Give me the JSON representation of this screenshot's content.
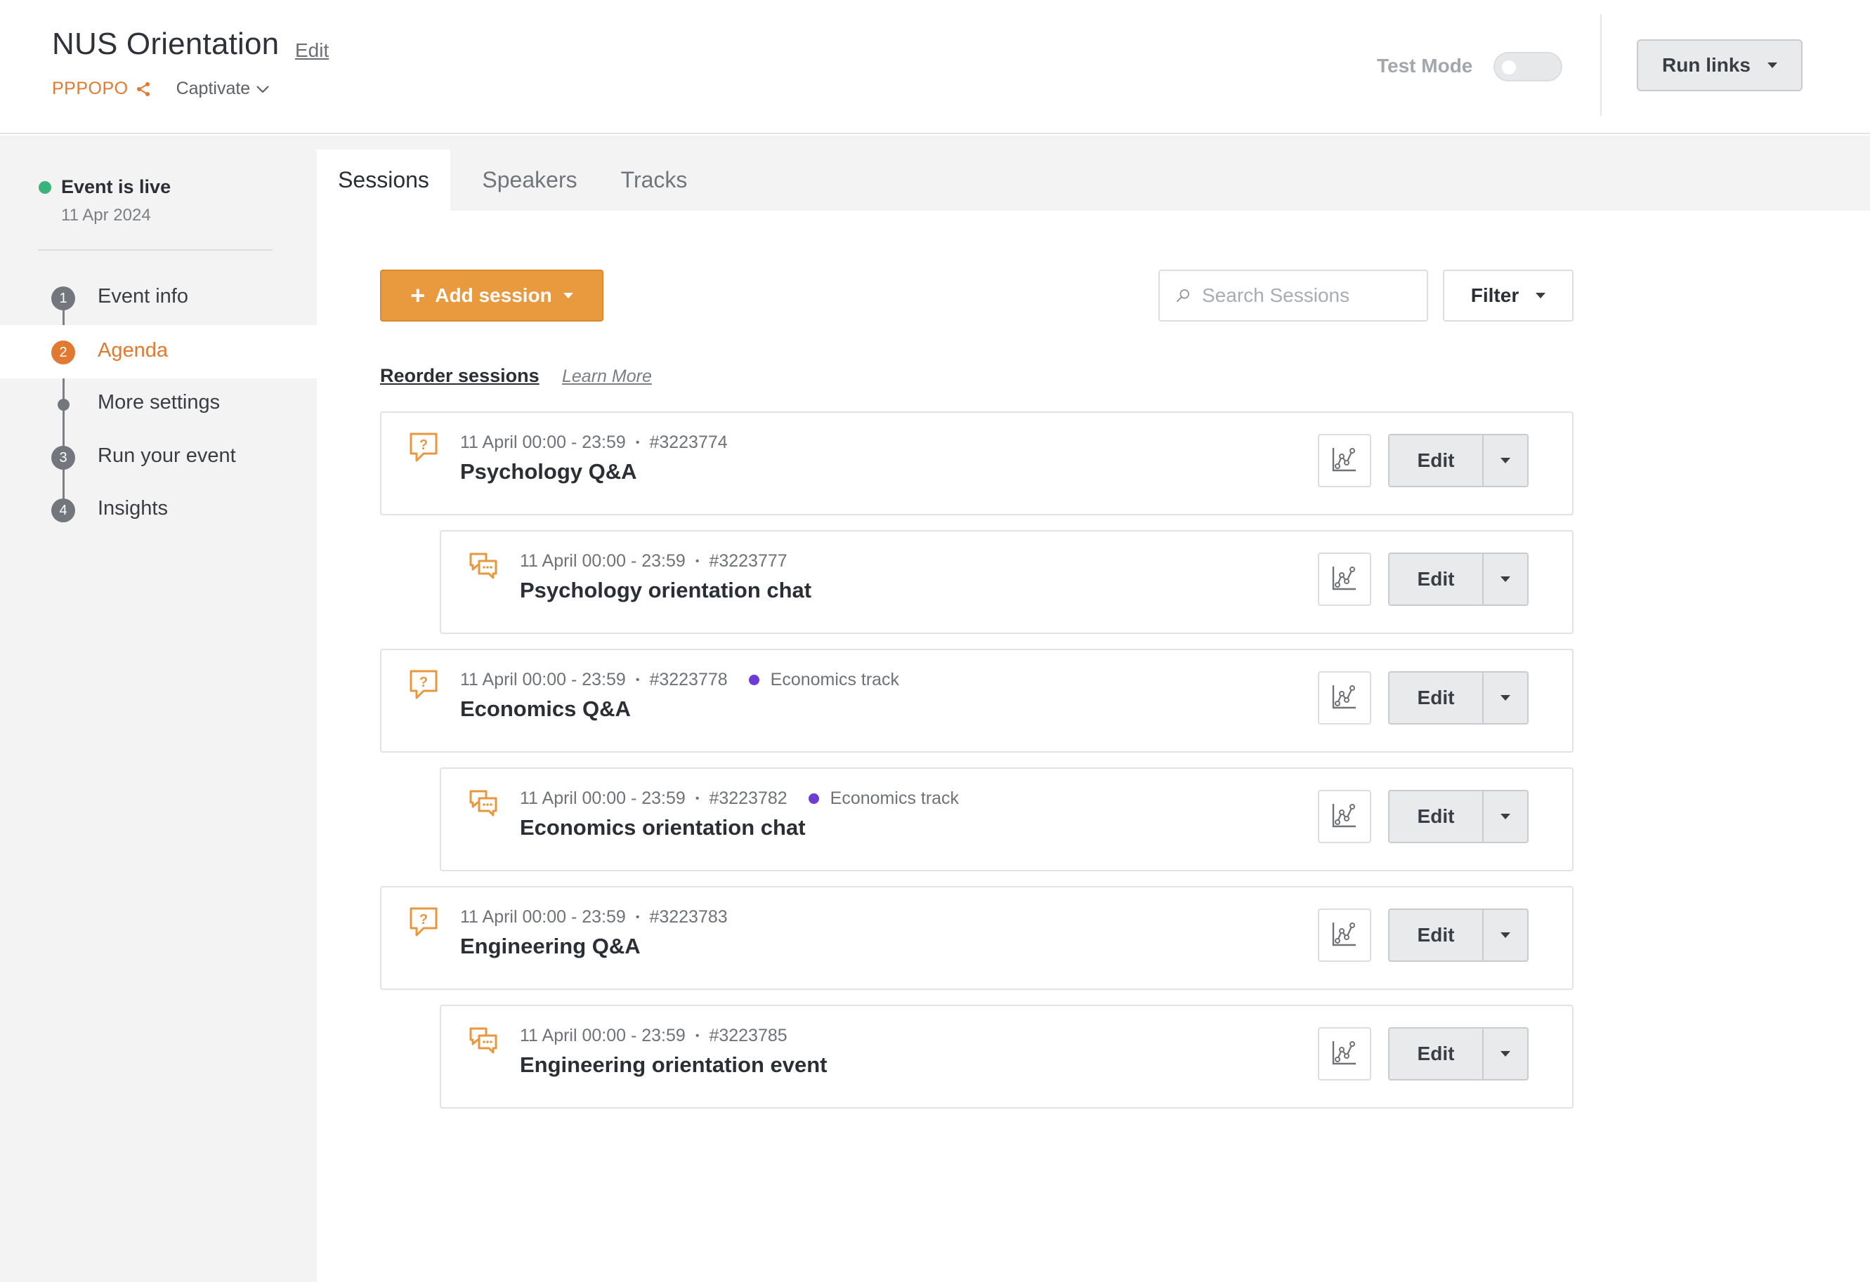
{
  "header": {
    "event_title": "NUS Orientation",
    "edit_label": "Edit",
    "org_code": "PPPOPO",
    "platform": "Captivate",
    "test_mode_label": "Test Mode",
    "test_mode_on": false,
    "run_links_label": "Run links"
  },
  "sidebar": {
    "status": "Event is live",
    "date": "11 Apr 2024",
    "steps": [
      {
        "number": "1",
        "label": "Event info",
        "active": false
      },
      {
        "number": "2",
        "label": "Agenda",
        "active": true
      },
      {
        "number": "",
        "label": "More settings",
        "active": false
      },
      {
        "number": "3",
        "label": "Run your event",
        "active": false
      },
      {
        "number": "4",
        "label": "Insights",
        "active": false
      }
    ]
  },
  "tabs": [
    {
      "label": "Sessions",
      "active": true
    },
    {
      "label": "Speakers",
      "active": false
    },
    {
      "label": "Tracks",
      "active": false
    }
  ],
  "toolbar": {
    "add_session_label": "Add session",
    "search_placeholder": "Search Sessions",
    "filter_label": "Filter",
    "reorder_label": "Reorder sessions",
    "learn_more_label": "Learn More"
  },
  "sessions": [
    {
      "type": "qa",
      "icon": "qa-bubble-icon",
      "time": "11 April 00:00 - 23:59",
      "id": "#3223774",
      "track": "",
      "title": "Psychology Q&A",
      "edit_label": "Edit"
    },
    {
      "type": "chat",
      "icon": "chat-bubbles-icon",
      "time": "11 April 00:00 - 23:59",
      "id": "#3223777",
      "track": "",
      "title": "Psychology orientation chat",
      "edit_label": "Edit"
    },
    {
      "type": "qa",
      "icon": "qa-bubble-icon",
      "time": "11 April 00:00 - 23:59",
      "id": "#3223778",
      "track": "Economics track",
      "title": "Economics Q&A",
      "edit_label": "Edit"
    },
    {
      "type": "chat",
      "icon": "chat-bubbles-icon",
      "time": "11 April 00:00 - 23:59",
      "id": "#3223782",
      "track": "Economics track",
      "title": "Economics orientation chat",
      "edit_label": "Edit"
    },
    {
      "type": "qa",
      "icon": "qa-bubble-icon",
      "time": "11 April 00:00 - 23:59",
      "id": "#3223783",
      "track": "",
      "title": "Engineering Q&A",
      "edit_label": "Edit"
    },
    {
      "type": "chat",
      "icon": "chat-bubbles-icon",
      "time": "11 April 00:00 - 23:59",
      "id": "#3223785",
      "track": "",
      "title": "Engineering orientation event",
      "edit_label": "Edit"
    }
  ],
  "colors": {
    "accent_orange": "#e07a30",
    "button_orange": "#ea9a3e",
    "live_green": "#3bb27a",
    "track_purple": "#6d3bd6"
  }
}
